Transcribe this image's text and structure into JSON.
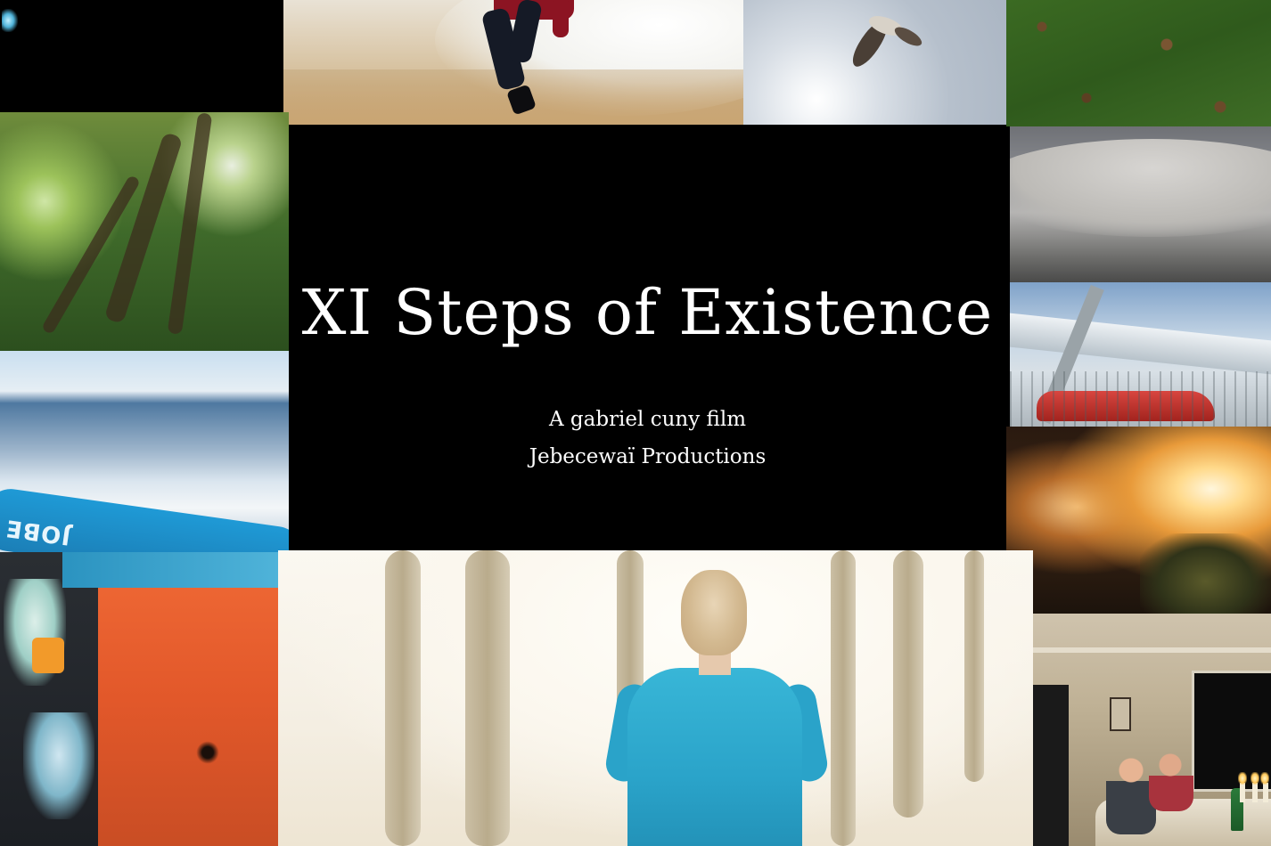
{
  "title_card": {
    "title": "XI Steps of Existence",
    "credit_line_1": "A gabriel cuny film",
    "credit_line_2": "Jebecewaï Productions"
  },
  "tiles": {
    "ocean_board_text": "JOBE",
    "scenes": [
      "dark-frame",
      "beach-runner",
      "bird-over-sun",
      "grass-leaves",
      "forest-motion-blur",
      "ocean-wake",
      "inverted-boat",
      "ceiling",
      "overpass-red-car",
      "fire",
      "dinner-candles",
      "person-in-blue-shirt"
    ]
  },
  "colors": {
    "background": "#000000",
    "title_text": "#ffffff"
  }
}
